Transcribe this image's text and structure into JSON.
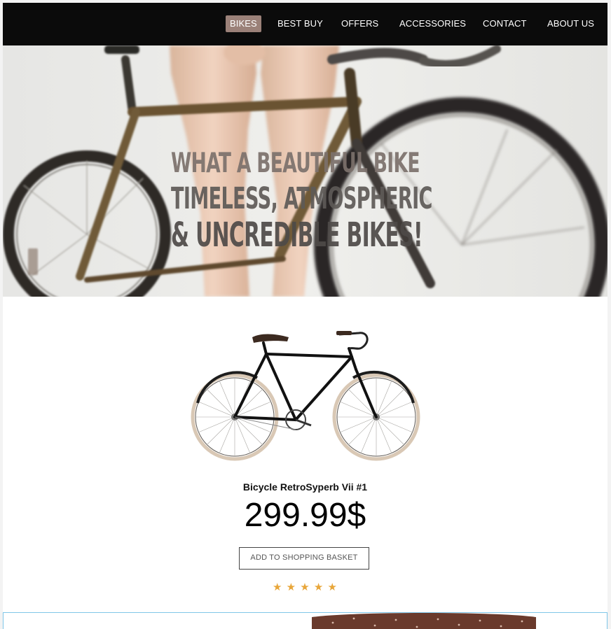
{
  "nav": {
    "items": [
      {
        "label": "BIKES",
        "active": true
      },
      {
        "label": "BEST BUY",
        "active": false
      },
      {
        "label": "OFFERS",
        "active": false
      },
      {
        "label": "ACCESSORIES",
        "active": false
      },
      {
        "label": "CONTACT",
        "active": false
      },
      {
        "label": "ABOUT US",
        "active": false
      }
    ],
    "active_color": "#9b8179"
  },
  "hero": {
    "line1": "WHAT A BEAUTIFUL BIKE",
    "line2": "TIMELESS, ATMOSPHERIC",
    "line3": "& UNCREDIBLE BIKES!"
  },
  "product": {
    "name": "Bicycle RetroSyperb Vii #1",
    "price": "299.99$",
    "button_label": "ADD TO SHOPPING BASKET",
    "rating": 5,
    "rating_icon": "star-icon",
    "star_color": "#e8a63a"
  }
}
